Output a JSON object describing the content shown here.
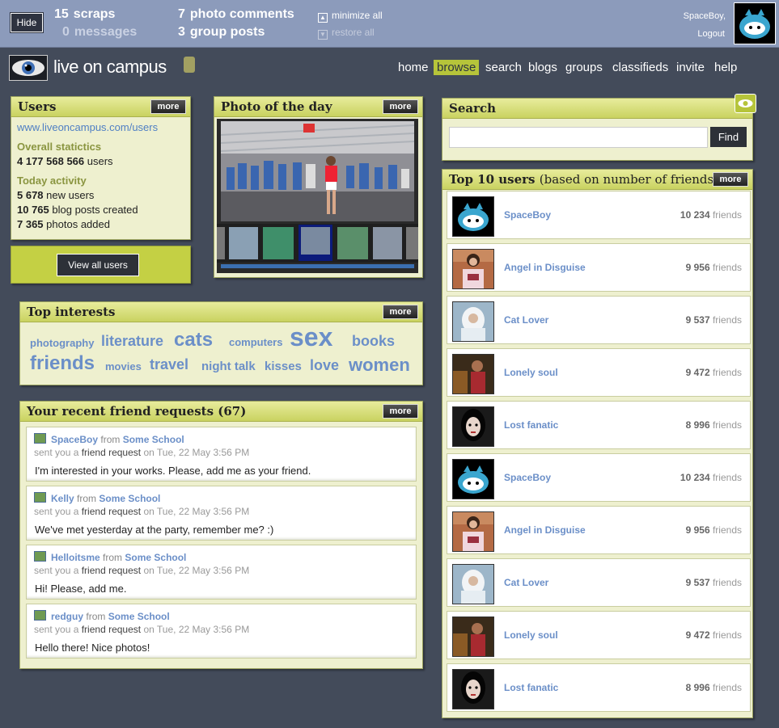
{
  "topbar": {
    "hide_label": "Hide",
    "scraps_count": "15",
    "scraps_label": "scraps",
    "messages_count": "0",
    "messages_label": "messages",
    "photo_comments_count": "7",
    "photo_comments_label": "photo comments",
    "group_posts_count": "3",
    "group_posts_label": "group posts",
    "minimize_all": "minimize all",
    "restore_all": "restore all",
    "username": "SpaceBoy,",
    "logout": "Logout"
  },
  "header": {
    "logo_text": "live on campus",
    "nav": [
      "home",
      "browse",
      "search",
      "blogs",
      "groups",
      "classifieds",
      "invite",
      "help"
    ],
    "active_nav": "browse"
  },
  "users_panel": {
    "title": "Users",
    "more": "more",
    "url": "www.liveoncampus.com/users",
    "overall_heading": "Overall statictics",
    "overall_count": "4 177 568 566",
    "overall_suffix": "users",
    "today_heading": "Today activity",
    "new_users_count": "5 678",
    "new_users_suffix": "new users",
    "blog_posts_count": "10 765",
    "blog_posts_suffix": "blog posts created",
    "photos_count": "7 365",
    "photos_suffix": "photos added",
    "view_all": "View all users"
  },
  "photo_panel": {
    "title": "Photo of the day",
    "more": "more"
  },
  "interests_panel": {
    "title": "Top interests",
    "more": "more",
    "tags": [
      "photography",
      "literature",
      "cats",
      "computers",
      "sex",
      "books",
      "friends",
      "movies",
      "travel",
      "night talk",
      "kisses",
      "love",
      "women"
    ]
  },
  "requests_panel": {
    "title": "Your recent friend requests (67)",
    "more": "more",
    "from_word": "from",
    "sent_prefix": "sent you a",
    "sent_mid": "friend request",
    "sent_suffix": "on Tue, 22 May 3:56 PM",
    "items": [
      {
        "user": "SpaceBoy",
        "school": "Some School",
        "message": "I'm interested in your works. Please, add me as your friend."
      },
      {
        "user": "Kelly",
        "school": "Some School",
        "message": "We've met yesterday at the party, remember me? :)"
      },
      {
        "user": "Helloitsme",
        "school": "Some School",
        "message": "Hi! Please, add me."
      },
      {
        "user": "redguy",
        "school": "Some School",
        "message": "Hello there! Nice photos!"
      }
    ]
  },
  "search_panel": {
    "title": "Search",
    "find": "Find",
    "placeholder": ""
  },
  "top_users_panel": {
    "title": "Top 10 users",
    "subtitle": "(based on number of friends)",
    "more": "more",
    "friends_word": "friends",
    "users": [
      {
        "name": "SpaceBoy",
        "friends": "10 234"
      },
      {
        "name": "Angel in Disguise",
        "friends": "9 956"
      },
      {
        "name": "Cat Lover",
        "friends": "9 537"
      },
      {
        "name": "Lonely soul",
        "friends": "9 472"
      },
      {
        "name": "Lost fanatic",
        "friends": "8 996"
      },
      {
        "name": "SpaceBoy",
        "friends": "10 234"
      },
      {
        "name": "Angel in Disguise",
        "friends": "9 956"
      },
      {
        "name": "Cat Lover",
        "friends": "9 537"
      },
      {
        "name": "Lonely soul",
        "friends": "9 472"
      },
      {
        "name": "Lost fanatic",
        "friends": "8 996"
      }
    ]
  },
  "colors": {
    "page_bg": "#434b5a",
    "topbar_bg": "#8c9bbb",
    "panel_bg": "#eef0cf",
    "accent": "#b6c43a",
    "link": "#4f7fc4"
  }
}
